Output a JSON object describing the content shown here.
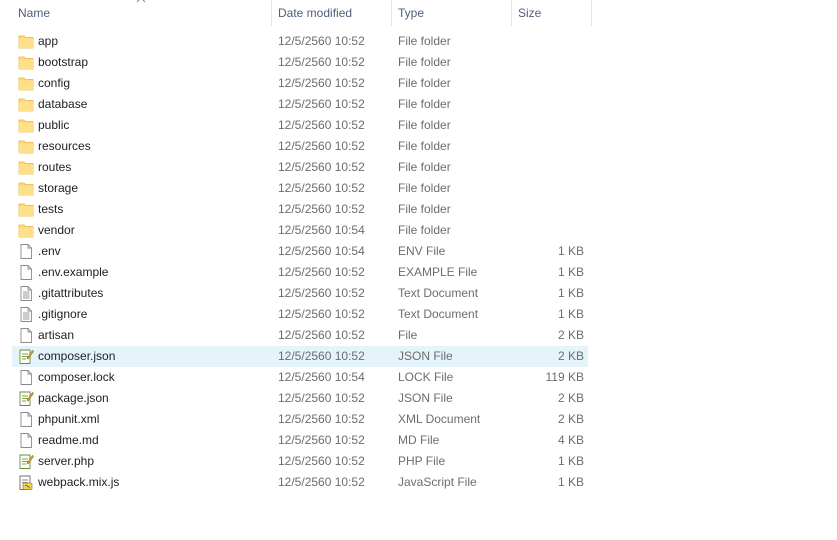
{
  "columns": {
    "name": "Name",
    "date": "Date modified",
    "type": "Type",
    "size": "Size"
  },
  "selected_index": 15,
  "icons": {
    "folder": "folder-icon",
    "file": "file-icon",
    "text": "text-file-icon",
    "script": "script-file-icon",
    "js": "javascript-file-icon"
  },
  "colors": {
    "folder": "#ffd96a",
    "selection": "#e5f3fb"
  },
  "files": [
    {
      "name": "app",
      "date": "12/5/2560 10:52",
      "type": "File folder",
      "size": "",
      "icon": "folder"
    },
    {
      "name": "bootstrap",
      "date": "12/5/2560 10:52",
      "type": "File folder",
      "size": "",
      "icon": "folder"
    },
    {
      "name": "config",
      "date": "12/5/2560 10:52",
      "type": "File folder",
      "size": "",
      "icon": "folder"
    },
    {
      "name": "database",
      "date": "12/5/2560 10:52",
      "type": "File folder",
      "size": "",
      "icon": "folder"
    },
    {
      "name": "public",
      "date": "12/5/2560 10:52",
      "type": "File folder",
      "size": "",
      "icon": "folder"
    },
    {
      "name": "resources",
      "date": "12/5/2560 10:52",
      "type": "File folder",
      "size": "",
      "icon": "folder"
    },
    {
      "name": "routes",
      "date": "12/5/2560 10:52",
      "type": "File folder",
      "size": "",
      "icon": "folder"
    },
    {
      "name": "storage",
      "date": "12/5/2560 10:52",
      "type": "File folder",
      "size": "",
      "icon": "folder"
    },
    {
      "name": "tests",
      "date": "12/5/2560 10:52",
      "type": "File folder",
      "size": "",
      "icon": "folder"
    },
    {
      "name": "vendor",
      "date": "12/5/2560 10:54",
      "type": "File folder",
      "size": "",
      "icon": "folder"
    },
    {
      "name": ".env",
      "date": "12/5/2560 10:54",
      "type": "ENV File",
      "size": "1 KB",
      "icon": "file"
    },
    {
      "name": ".env.example",
      "date": "12/5/2560 10:52",
      "type": "EXAMPLE File",
      "size": "1 KB",
      "icon": "file"
    },
    {
      "name": ".gitattributes",
      "date": "12/5/2560 10:52",
      "type": "Text Document",
      "size": "1 KB",
      "icon": "text"
    },
    {
      "name": ".gitignore",
      "date": "12/5/2560 10:52",
      "type": "Text Document",
      "size": "1 KB",
      "icon": "text"
    },
    {
      "name": "artisan",
      "date": "12/5/2560 10:52",
      "type": "File",
      "size": "2 KB",
      "icon": "file"
    },
    {
      "name": "composer.json",
      "date": "12/5/2560 10:52",
      "type": "JSON File",
      "size": "2 KB",
      "icon": "script"
    },
    {
      "name": "composer.lock",
      "date": "12/5/2560 10:54",
      "type": "LOCK File",
      "size": "119 KB",
      "icon": "file"
    },
    {
      "name": "package.json",
      "date": "12/5/2560 10:52",
      "type": "JSON File",
      "size": "2 KB",
      "icon": "script"
    },
    {
      "name": "phpunit.xml",
      "date": "12/5/2560 10:52",
      "type": "XML Document",
      "size": "2 KB",
      "icon": "file"
    },
    {
      "name": "readme.md",
      "date": "12/5/2560 10:52",
      "type": "MD File",
      "size": "4 KB",
      "icon": "file"
    },
    {
      "name": "server.php",
      "date": "12/5/2560 10:52",
      "type": "PHP File",
      "size": "1 KB",
      "icon": "script"
    },
    {
      "name": "webpack.mix.js",
      "date": "12/5/2560 10:52",
      "type": "JavaScript File",
      "size": "1 KB",
      "icon": "js"
    }
  ]
}
